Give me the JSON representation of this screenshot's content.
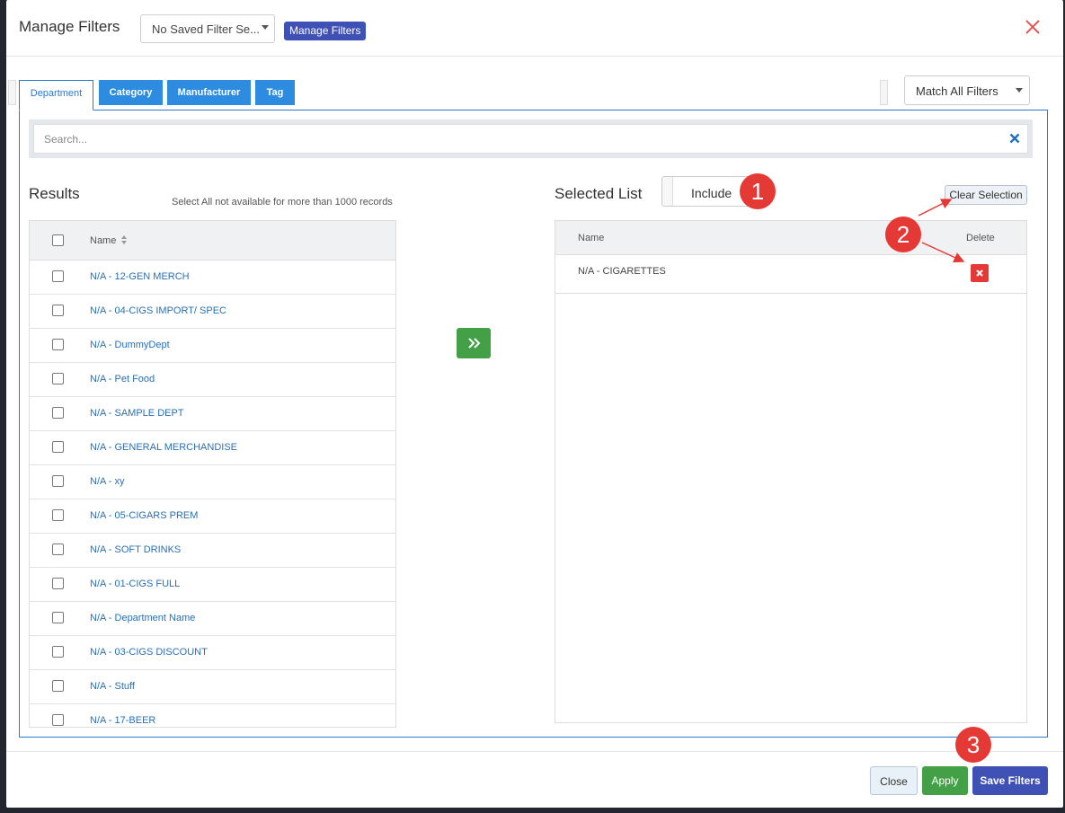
{
  "modal": {
    "title": "Manage Filters",
    "saved_filter_select": "No Saved Filter Se...",
    "manage_filters_button": "Manage Filters"
  },
  "tabs": [
    {
      "label": "Department",
      "active": true
    },
    {
      "label": "Category",
      "active": false
    },
    {
      "label": "Manufacturer",
      "active": false
    },
    {
      "label": "Tag",
      "active": false
    }
  ],
  "match_select": "Match All Filters",
  "search": {
    "placeholder": "Search..."
  },
  "results": {
    "title": "Results",
    "note": "Select All not available for more than 1000 records",
    "column_name": "Name",
    "rows": [
      "N/A - 12-GEN MERCH",
      "N/A - 04-CIGS IMPORT/ SPEC",
      "N/A - DummyDept",
      "N/A - Pet Food",
      "N/A - SAMPLE DEPT",
      "N/A - GENERAL MERCHANDISE",
      "N/A - xy",
      "N/A - 05-CIGARS PREM",
      "N/A - SOFT DRINKS",
      "N/A - 01-CIGS FULL",
      "N/A - Department Name",
      "N/A - 03-CIGS DISCOUNT",
      "N/A - Stuff",
      "N/A - 17-BEER"
    ]
  },
  "selected": {
    "title": "Selected List",
    "include_label": "Include",
    "clear_selection": "Clear Selection",
    "column_name": "Name",
    "column_delete": "Delete",
    "rows": [
      "N/A - CIGARETTES"
    ]
  },
  "footer": {
    "close": "Close",
    "apply": "Apply",
    "save": "Save Filters"
  },
  "annotations": [
    "1",
    "2",
    "3"
  ],
  "colors": {
    "primary_blue": "#2d8ce0",
    "indigo": "#3f51b5",
    "green": "#43a047",
    "red": "#e53935"
  }
}
